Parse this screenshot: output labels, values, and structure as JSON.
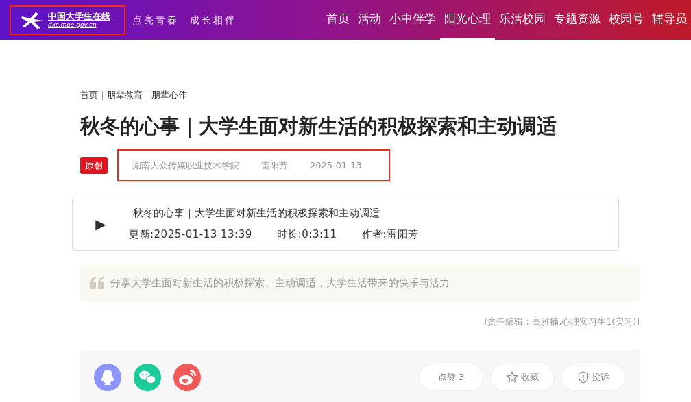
{
  "header": {
    "logo": {
      "name": "中国大学生在线",
      "url": "dxs.moe.gov.cn",
      "highlighted": true
    },
    "slogan": [
      "点亮青春",
      "成长相伴"
    ],
    "nav": [
      {
        "label": "首页",
        "selected": false
      },
      {
        "label": "活动",
        "selected": false
      },
      {
        "label": "小中伴学",
        "selected": false
      },
      {
        "label": "阳光心理",
        "selected": true
      },
      {
        "label": "乐活校园",
        "selected": false
      },
      {
        "label": "专题资源",
        "selected": false
      },
      {
        "label": "校园号",
        "selected": false
      },
      {
        "label": "辅导员",
        "selected": false
      }
    ]
  },
  "breadcrumb": [
    "首页",
    "朋辈教育",
    "朋辈心作"
  ],
  "article": {
    "title": "秋冬的心事｜大学生面对新生活的积极探索和主动调适",
    "badge": "原创",
    "meta": {
      "highlighted": true,
      "source": "湖南大众传媒职业技术学院",
      "author": "雷阳芳",
      "date": "2025-01-13"
    }
  },
  "audio": {
    "play_icon": "▶",
    "title": "秋冬的心事｜大学生面对新生活的积极探索和主动调适",
    "updated": "更新:2025-01-13 13:39",
    "duration": "时长:0:3:11",
    "author": "作者:雷阳芳"
  },
  "summary": "分享大学生面对新生活的积极探索、主动调适，大学生活带来的快乐与活力",
  "editor": "[责任编辑：高雅楠,心理实习生1(实习)]",
  "share": {
    "icons": [
      {
        "kind": "qq",
        "color": "#8b95fb"
      },
      {
        "kind": "wechat",
        "color": "#1dcb98"
      },
      {
        "kind": "weibo",
        "color": "#f25a5a"
      }
    ],
    "actions": [
      {
        "kind": "like",
        "label": "点赞 3"
      },
      {
        "kind": "favorite",
        "label": "收藏"
      },
      {
        "kind": "report",
        "label": "投诉"
      }
    ]
  }
}
